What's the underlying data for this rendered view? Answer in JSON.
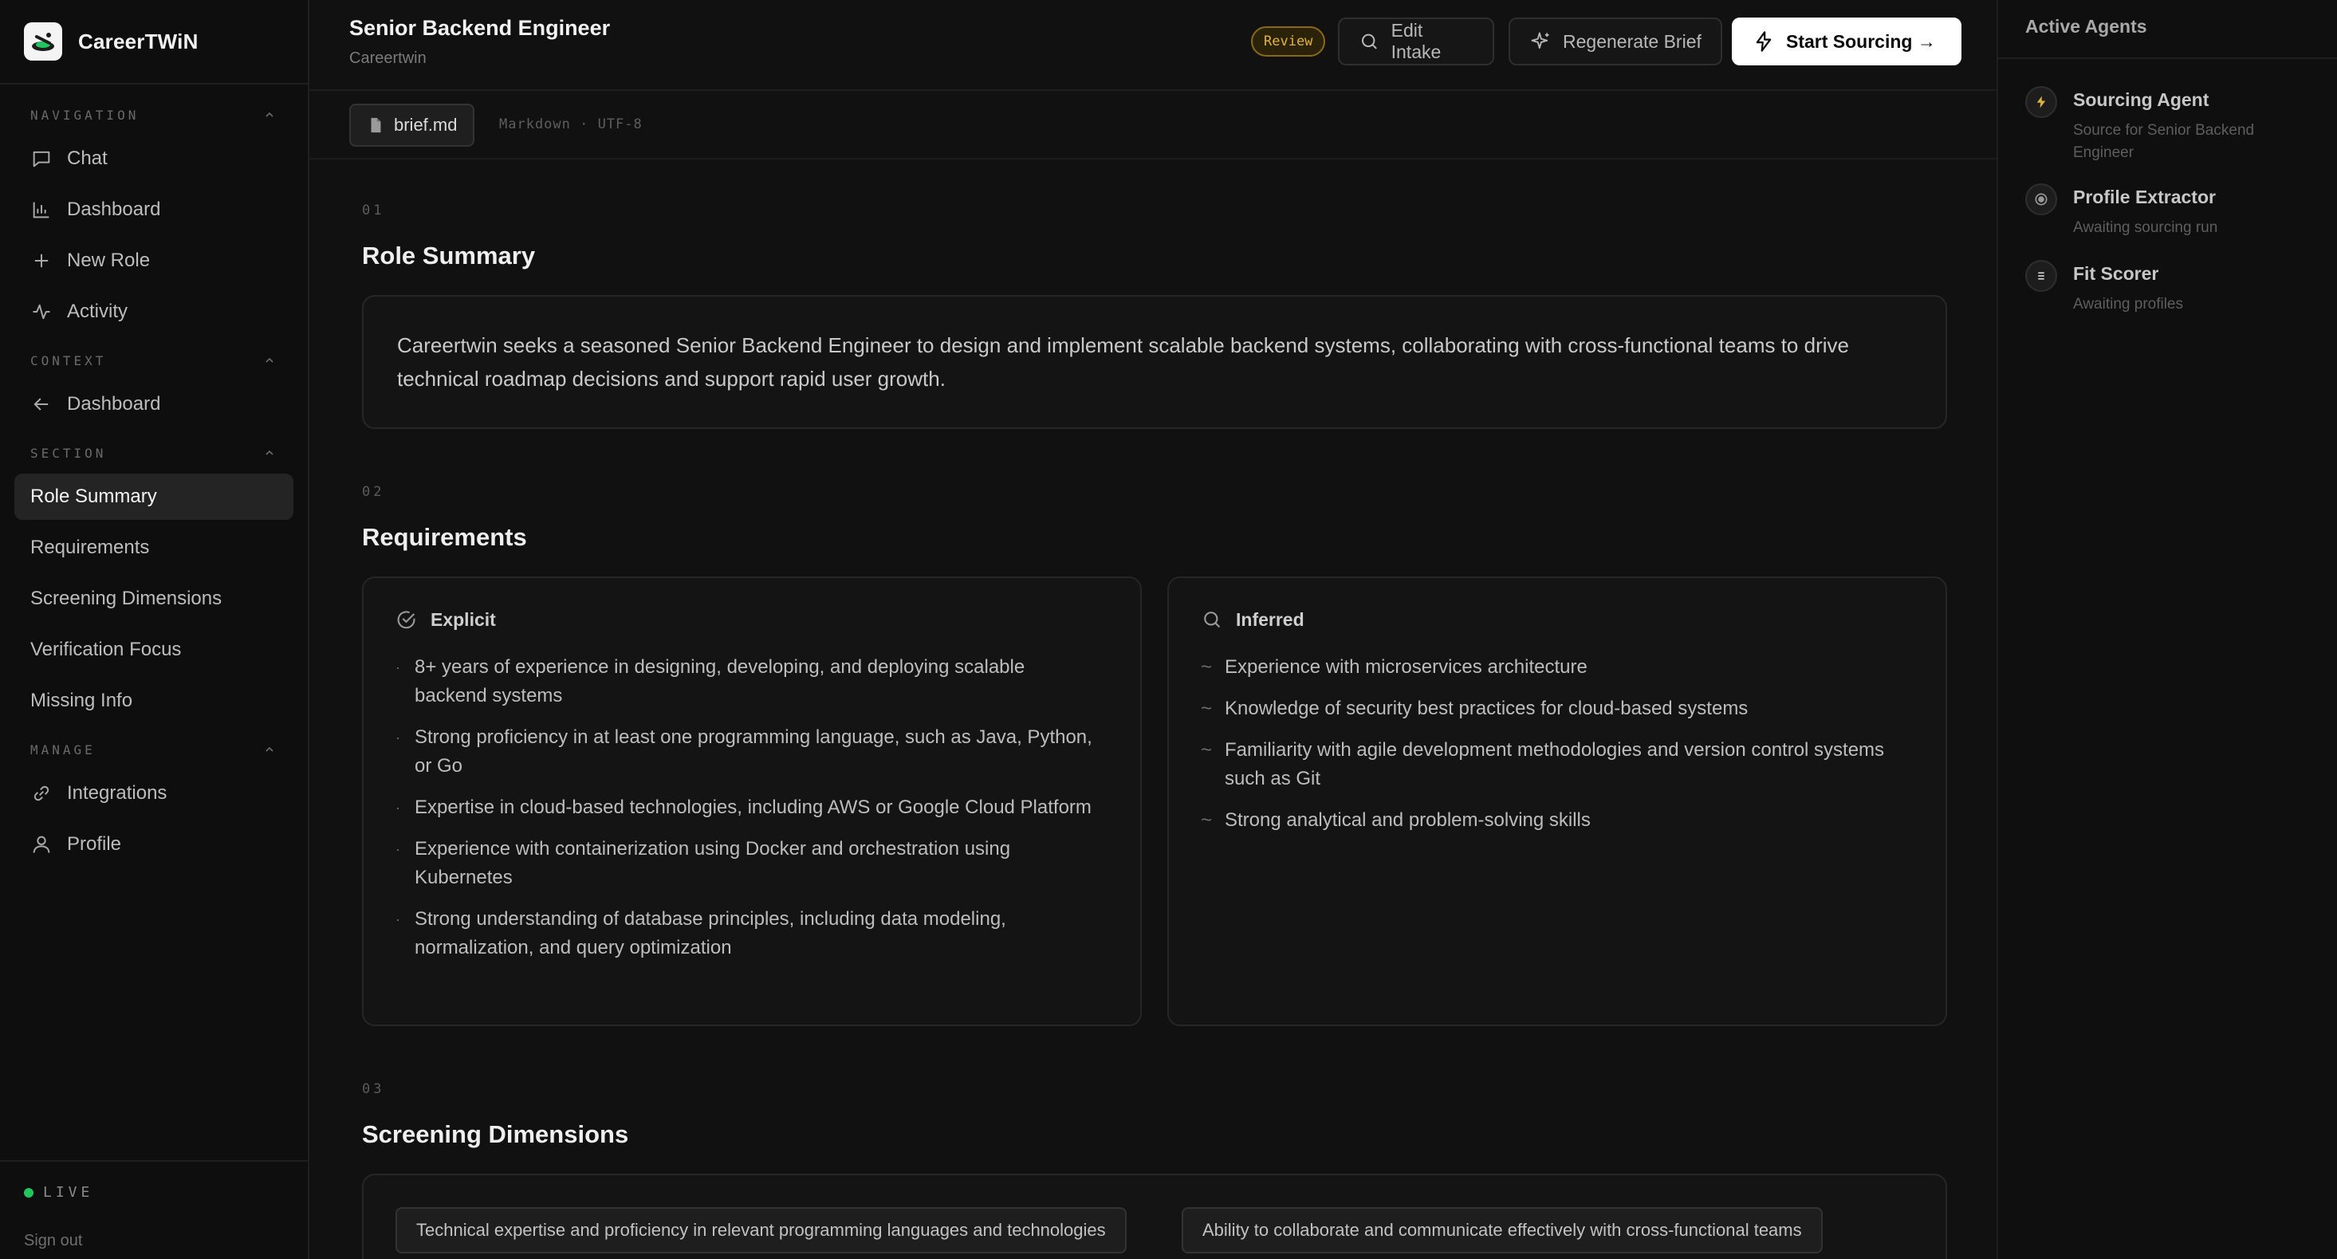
{
  "brand": {
    "name": "CareerTWiN"
  },
  "sidebar": {
    "groups": {
      "navigation": "NAVIGATION",
      "context": "CONTEXT",
      "section": "SECTION",
      "manage": "MANAGE"
    },
    "nav": [
      {
        "label": "Chat",
        "icon": "chat-icon"
      },
      {
        "label": "Dashboard",
        "icon": "bar-chart-icon"
      },
      {
        "label": "New Role",
        "icon": "plus-icon"
      },
      {
        "label": "Activity",
        "icon": "activity-icon"
      }
    ],
    "context": [
      {
        "label": "Dashboard",
        "icon": "arrow-left-icon"
      }
    ],
    "section": [
      {
        "label": "Role Summary",
        "active": true
      },
      {
        "label": "Requirements"
      },
      {
        "label": "Screening Dimensions"
      },
      {
        "label": "Verification Focus"
      },
      {
        "label": "Missing Info"
      }
    ],
    "manage": [
      {
        "label": "Integrations",
        "icon": "link-icon"
      },
      {
        "label": "Profile",
        "icon": "user-icon"
      }
    ],
    "status": "LIVE",
    "signout": "Sign out"
  },
  "header": {
    "title": "Senior Backend Engineer",
    "subtitle": "Careertwin",
    "badge": "Review",
    "edit_label": "Edit Intake",
    "regen_label": "Regenerate Brief",
    "start_label": "Start Sourcing →"
  },
  "file": {
    "name": "brief.md",
    "meta": "Markdown · UTF-8"
  },
  "sections": {
    "summary": {
      "num": "01",
      "title": "Role Summary",
      "text": "Careertwin seeks a seasoned Senior Backend Engineer to design and implement scalable backend systems, collaborating with cross-functional teams to drive technical roadmap decisions and support rapid user growth."
    },
    "requirements": {
      "num": "02",
      "title": "Requirements",
      "explicit_label": "Explicit",
      "inferred_label": "Inferred",
      "explicit": [
        "8+ years of experience in designing, developing, and deploying scalable backend systems",
        "Strong proficiency in at least one programming language, such as Java, Python, or Go",
        "Expertise in cloud-based technologies, including AWS or Google Cloud Platform",
        "Experience with containerization using Docker and orchestration using Kubernetes",
        "Strong understanding of database principles, including data modeling, normalization, and query optimization"
      ],
      "inferred": [
        "Experience with microservices architecture",
        "Knowledge of security best practices for cloud-based systems",
        "Familiarity with agile development methodologies and version control systems such as Git",
        "Strong analytical and problem-solving skills"
      ]
    },
    "screening": {
      "num": "03",
      "title": "Screening Dimensions",
      "chips": [
        "Technical expertise and proficiency in relevant programming languages and technologies",
        "Ability to collaborate and communicate effectively with cross-functional teams"
      ]
    }
  },
  "agents": {
    "title": "Active Agents",
    "items": [
      {
        "name": "Sourcing Agent",
        "desc": "Source for Senior Backend Engineer",
        "icon": "bolt-icon"
      },
      {
        "name": "Profile Extractor",
        "desc": "Awaiting sourcing run",
        "icon": "target-icon"
      },
      {
        "name": "Fit Scorer",
        "desc": "Awaiting profiles",
        "icon": "list-icon"
      }
    ]
  },
  "colors": {
    "background": "#111111",
    "accent_review": "#e0b43a",
    "live": "#22c55e"
  }
}
